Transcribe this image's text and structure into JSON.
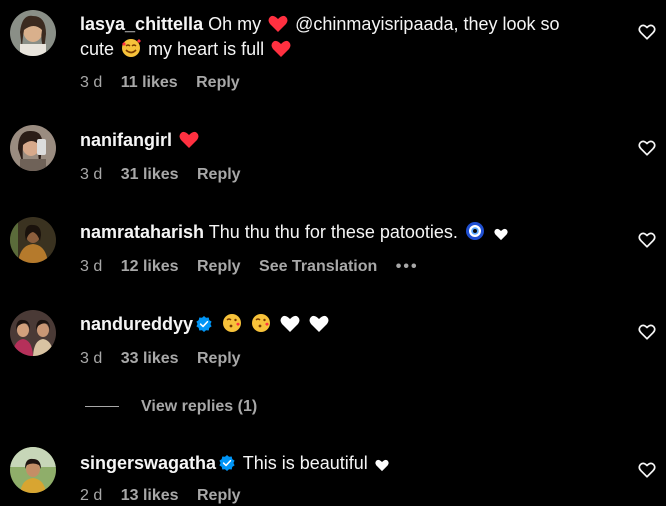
{
  "comments": [
    {
      "username": "lasya_chittella",
      "text_before": "Oh my",
      "mention": "@chinmayisripaada",
      "text_mid": ", they look so",
      "text_line2_a": "cute",
      "text_line2_b": "my heart is full",
      "time": "3 d",
      "likes": "11 likes",
      "reply": "Reply"
    },
    {
      "username": "nanifangirl",
      "time": "3 d",
      "likes": "31 likes",
      "reply": "Reply"
    },
    {
      "username": "namrataharish",
      "text": "Thu thu thu for these patooties.",
      "time": "3 d",
      "likes": "12 likes",
      "reply": "Reply",
      "see_translation": "See Translation",
      "more": "•••"
    },
    {
      "username": "nandureddyy",
      "time": "3 d",
      "likes": "33 likes",
      "reply": "Reply",
      "view_replies": "View replies (1)"
    },
    {
      "username": "singerswagatha",
      "text": "This is beautiful",
      "time": "2 d",
      "likes": "13 likes",
      "reply": "Reply"
    }
  ],
  "colors": {
    "background": "#000000",
    "text": "#f5f5f5",
    "secondary": "#a8a8a8",
    "heart_red": "#ff3040",
    "verified_blue": "#0095f6"
  }
}
